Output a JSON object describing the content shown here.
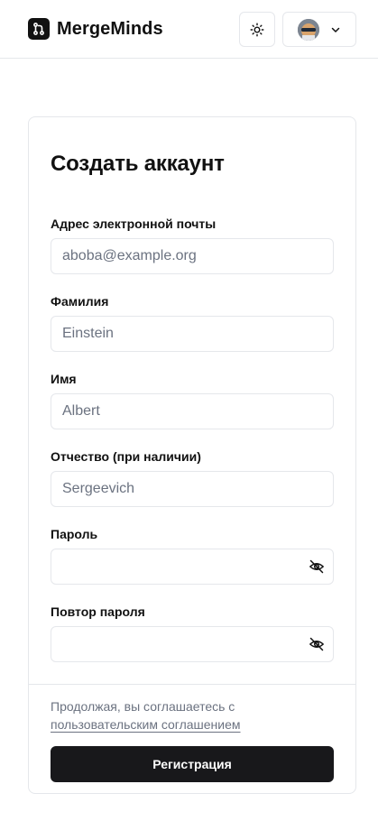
{
  "header": {
    "brand": "MergeMinds"
  },
  "form": {
    "title": "Создать аккаунт",
    "email": {
      "label": "Адрес электронной почты",
      "placeholder": "aboba@example.org"
    },
    "last_name": {
      "label": "Фамилия",
      "placeholder": "Einstein"
    },
    "first_name": {
      "label": "Имя",
      "placeholder": "Albert"
    },
    "middle_name": {
      "label": "Отчество (при наличии)",
      "placeholder": "Sergeevich"
    },
    "password": {
      "label": "Пароль"
    },
    "password_repeat": {
      "label": "Повтор пароля"
    },
    "terms_prefix": "Продолжая, вы соглашаетесь с",
    "terms_link": "пользовательским соглашением",
    "submit_label": "Регистрация"
  },
  "icons": {
    "logo": "merge-branch-icon",
    "theme_toggle": "sun-icon",
    "user_menu": "chevron-down-icon",
    "password_visibility": "eye-off-icon"
  },
  "colors": {
    "primary_button": "#18181b",
    "border": "#e5e7eb",
    "muted_text": "#6b7280"
  }
}
